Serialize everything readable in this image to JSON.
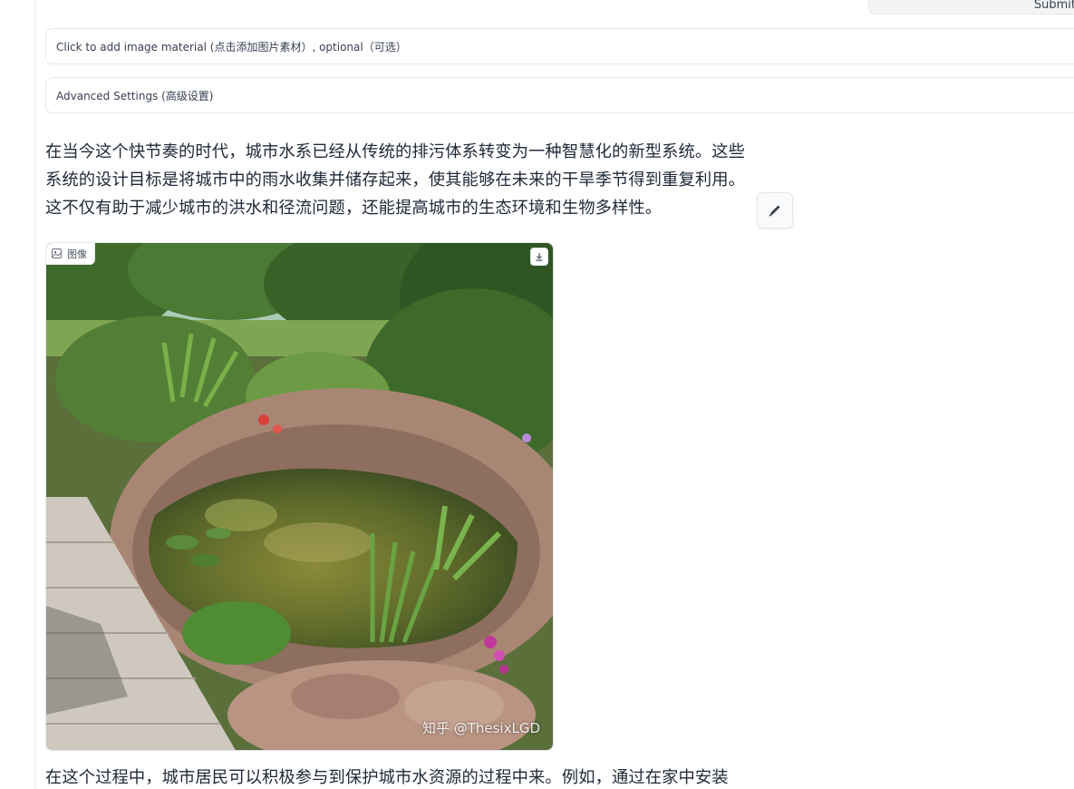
{
  "header": {
    "submit_label": "Submit"
  },
  "accordions": {
    "image_material": "Click to add image material (点击添加图片素材）, optional（可选）",
    "advanced_settings": "Advanced Settings (高级设置)"
  },
  "content": {
    "paragraph_1": "在当今这个快节奏的时代，城市水系已经从传统的排污体系转变为一种智慧化的新型系统。这些系统的设计目标是将城市中的雨水收集并储存起来，使其能够在未来的干旱季节得到重复利用。这不仅有助于减少城市的洪水和径流问题，还能提高城市的生态环境和生物多样性。",
    "paragraph_2": "在这个过程中，城市居民可以积极参与到保护城市水资源的过程中来。例如，通过在家中安装",
    "image": {
      "label": "图像",
      "watermark": "知乎 @ThesixLGD",
      "label_icon": "image-icon",
      "download_icon": "download-icon"
    },
    "edit_icon": "pen-icon"
  }
}
